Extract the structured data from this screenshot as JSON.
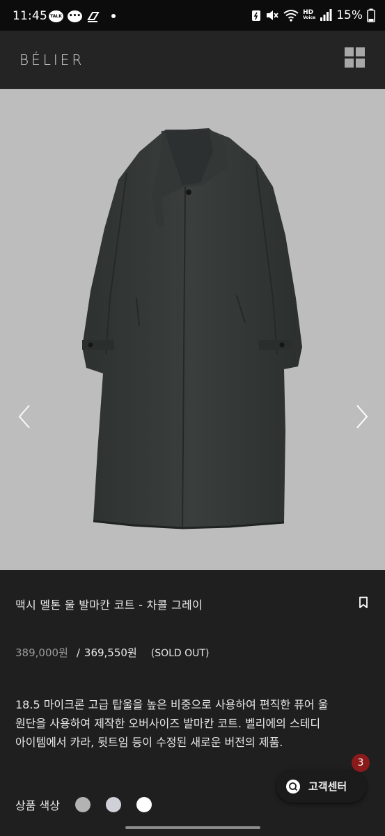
{
  "status_bar": {
    "time": "11:45",
    "talk_label": "TALK",
    "battery": "15%",
    "hd_label": "HD",
    "voice_label": "Voice"
  },
  "header": {
    "logo": "BÉLIER",
    "menu_icon": "grid-menu-icon"
  },
  "gallery": {
    "prev_icon": "chevron-left-icon",
    "next_icon": "chevron-right-icon",
    "image_alt": "charcoal gray wool balmacaan coat"
  },
  "product": {
    "title": "맥시 멜톤 울 발마칸 코트 - 차콜 그레이",
    "original_price": "389,000원",
    "slash": "/",
    "sale_price": "369,550원",
    "status": "(SOLD OUT)",
    "description": [
      "18.5 마이크론 고급 탑울을 높은 비중으로 사용하여 편직한 퓨어 울",
      "원단을 사용하여 제작한 오버사이즈 발마칸 코트. 벨리에의 스테디",
      "아이템에서 카라, 뒷트임 등이 수정된 새로운 버전의 제품."
    ],
    "color_label": "상품 색상",
    "colors": [
      "#b3b3b3",
      "#d0d0d8",
      "#ffffff"
    ]
  },
  "support": {
    "label": "고객센터",
    "badge": "3"
  }
}
